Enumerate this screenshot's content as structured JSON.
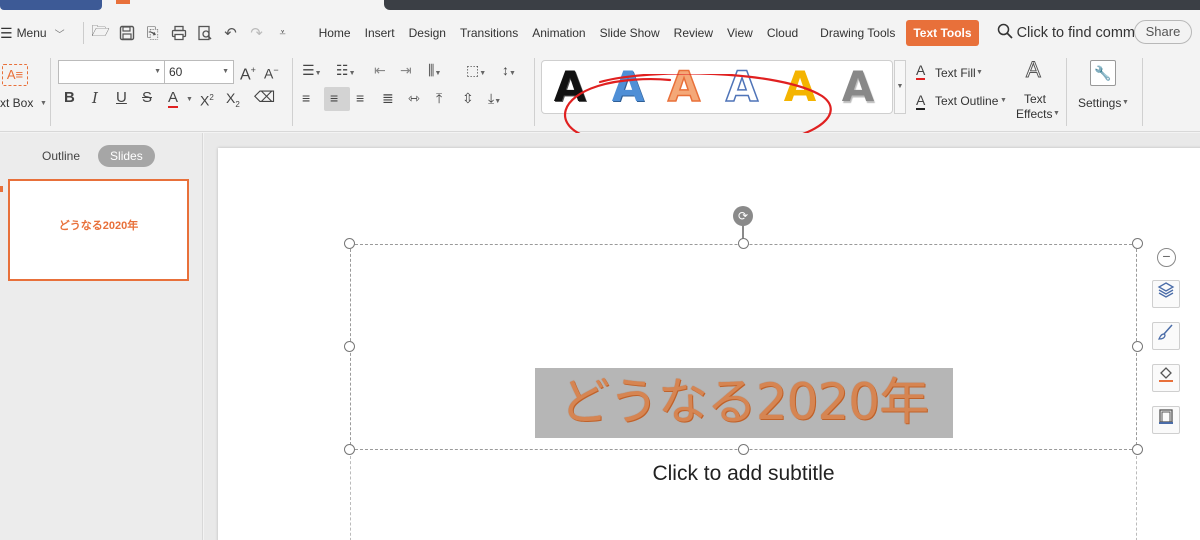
{
  "menubar": {
    "menu_label": "Menu",
    "tabs": [
      "Home",
      "Insert",
      "Design",
      "Transitions",
      "Animation",
      "Slide Show",
      "Review",
      "View",
      "Cloud",
      "Drawing Tools",
      "Text Tools"
    ],
    "active_tab": "Text Tools",
    "find_label": "Click to find commands",
    "share_label": "Share"
  },
  "ribbon": {
    "textbox_label": "xt Box",
    "font_name": "",
    "font_size": "60",
    "text_fill_label": "Text Fill",
    "text_outline_label": "Text Outline",
    "text_effects_label_1": "Text",
    "text_effects_label_2": "Effects",
    "settings_label": "Settings",
    "wordart_styles": [
      {
        "glyph": "A",
        "fill": "#000000"
      },
      {
        "glyph": "A",
        "fill": "#4f8fd6"
      },
      {
        "glyph": "A",
        "fill": "#f08a4b"
      },
      {
        "glyph": "A",
        "fill": "#ffffff"
      },
      {
        "glyph": "A",
        "fill": "#f4b400"
      },
      {
        "glyph": "A",
        "fill": "#888888"
      }
    ]
  },
  "left_panel": {
    "tab_outline": "Outline",
    "tab_slides": "Slides",
    "thumbnail_title": "どうなる2020年"
  },
  "slide": {
    "title": "どうなる2020年",
    "subtitle_placeholder": "Click to add subtitle"
  },
  "colors": {
    "accent": "#e8703a",
    "title_text": "#d68552",
    "annotation": "#e02020"
  }
}
